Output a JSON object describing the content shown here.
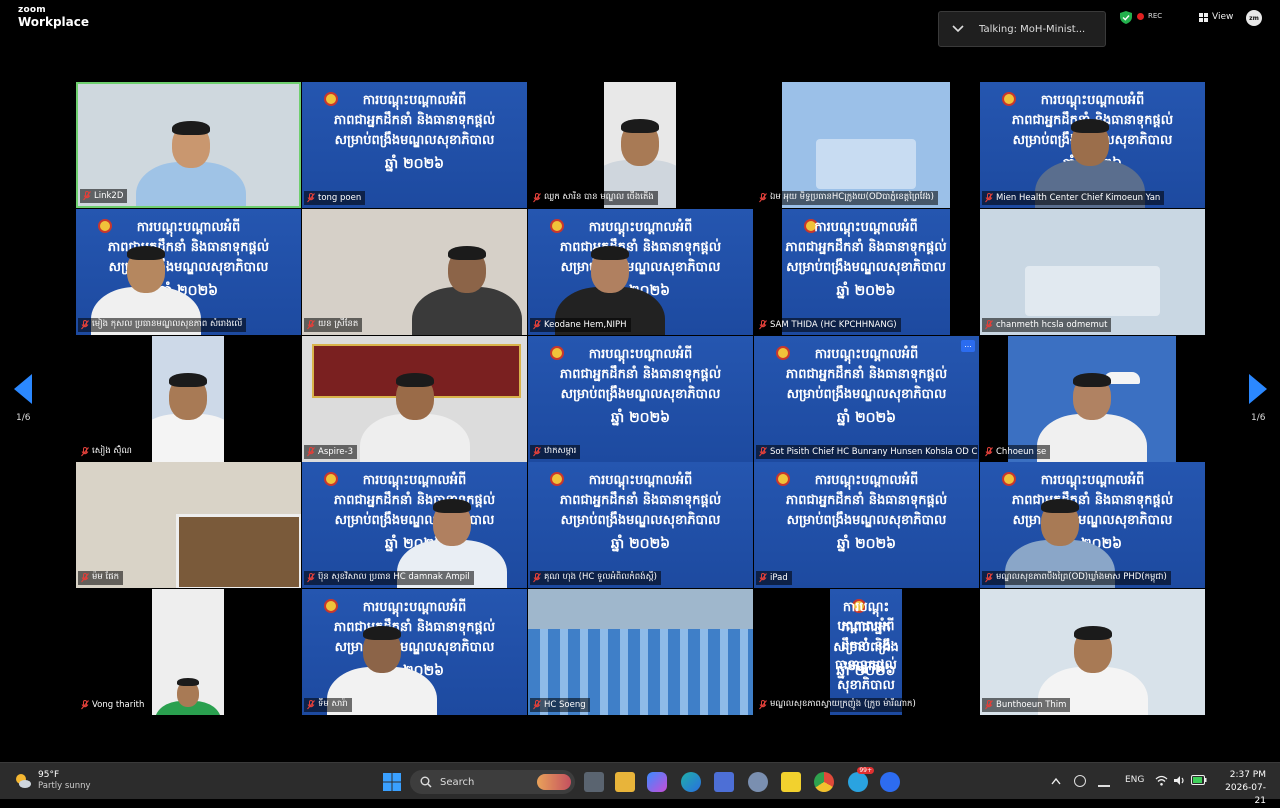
{
  "app": {
    "brand_small": "zoom",
    "brand_large": "Workplace"
  },
  "header": {
    "talking_label": "Talking:",
    "talking_name": "MoH-Minist...",
    "rec_label": "REC",
    "view_label": "View",
    "avatar_label": "zm"
  },
  "pager": {
    "left": "1/6",
    "right": "1/6"
  },
  "slide": {
    "line1": "ការបណ្តុះបណ្តាលអំពី",
    "line2": "ភាពជាអ្នកដឹកនាំ និងធានាទុកផ្តល់",
    "line3": "សម្រាប់ពង្រឹងមណ្ឌលសុខាភិបាល",
    "line4": "ឆ្នាំ ២០២៦"
  },
  "participants": [
    {
      "name": "Link2D"
    },
    {
      "name": "tong poen"
    },
    {
      "name": "ឈ្លក សារិន បាន មណ្ឌល ចើងតើង"
    },
    {
      "name": "ឯម អុយ មិទ្ធប្រធានHCក្រូងយ(ODបាភ្នំខេត្តព្រៃវែង)"
    },
    {
      "name": "Mien Health Center Chief Kimoeun Yan"
    },
    {
      "name": "មៀង កុសល ប្រធានមណ្ឌលសុខភាព សំរោងលើ"
    },
    {
      "name": "យន ស្រីនែត"
    },
    {
      "name": "Keodane Hem,NIPH"
    },
    {
      "name": "SAM THIDA (HC KPCHHNANG)"
    },
    {
      "name": "chanmeth hcsla odmemut"
    },
    {
      "name": "សៀង ស៊ុំណ"
    },
    {
      "name": "Aspire-3"
    },
    {
      "name": "ឋាកសម្ភារ"
    },
    {
      "name": "Sot Pisith Chief HC Bunrany Hunsen Kohsla OD C..."
    },
    {
      "name": "Chhoeun se"
    },
    {
      "name": "ម៉ម ផែក"
    },
    {
      "name": "ប៊ុន សុខវិសាល ប្រធាន HC damnak Ampil"
    },
    {
      "name": "គុណ ហុង (HC ទួលអំពិលកំពង់ស្ពឺ)"
    },
    {
      "name": "iPad"
    },
    {
      "name": "មណ្ឌលសុខភាពបឹងព្រៃ(OD)ឃ្លាំងមាស PHD(កម្ពុជា)"
    },
    {
      "name": "Vong tharith"
    },
    {
      "name": "ទីម សារ៉ា"
    },
    {
      "name": "HC Soeng"
    },
    {
      "name": "មណ្ឌលសុខភាពស្វាយក្រញ៉ូង (ក្រូច ម៉ារីណាក)"
    },
    {
      "name": "Bunthoeun Thim"
    }
  ],
  "taskbar": {
    "temperature": "95°F",
    "weather": "Partly sunny",
    "search_label": "Search",
    "language": "ENG",
    "time": "2:37 PM",
    "date": "2026-07-21",
    "badge": "99+"
  },
  "colors": {
    "slide_blue": "#1f4fa6",
    "active_border": "#6fcf6f",
    "rec_red": "#e02020",
    "muted_red": "#e0403a"
  }
}
